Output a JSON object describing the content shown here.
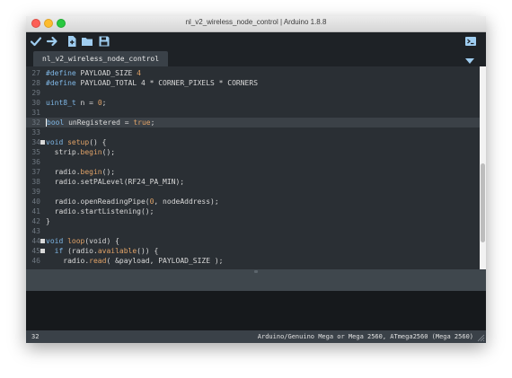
{
  "window": {
    "title": "nl_v2_wireless_node_control | Arduino 1.8.8"
  },
  "toolbar": {
    "verify_icon": "checkmark-icon",
    "upload_icon": "arrow-right-icon",
    "new_icon": "new-file-icon",
    "open_icon": "folder-icon",
    "save_icon": "floppy-icon",
    "serial_icon": "serial-monitor-icon"
  },
  "tabs": [
    {
      "label": "nl_v2_wireless_node_control"
    }
  ],
  "editor": {
    "current_line": 32,
    "lines": [
      {
        "n": "27",
        "segments": [
          {
            "t": "#define",
            "c": "dir"
          },
          {
            "t": " PAYLOAD_SIZE ",
            "c": ""
          },
          {
            "t": "4",
            "c": "val"
          }
        ]
      },
      {
        "n": "28",
        "segments": [
          {
            "t": "#define",
            "c": "dir"
          },
          {
            "t": " PAYLOAD_TOTAL 4 * CORNER_PIXELS * CORNERS",
            "c": ""
          }
        ]
      },
      {
        "n": "29",
        "segments": []
      },
      {
        "n": "30",
        "segments": [
          {
            "t": "uint8_t",
            "c": "kw"
          },
          {
            "t": " n = ",
            "c": ""
          },
          {
            "t": "0",
            "c": "val"
          },
          {
            "t": ";",
            "c": ""
          }
        ]
      },
      {
        "n": "31",
        "segments": []
      },
      {
        "n": "32",
        "current": true,
        "segments": [
          {
            "t": "bool",
            "c": "kw"
          },
          {
            "t": " unRegistered = ",
            "c": ""
          },
          {
            "t": "true",
            "c": "val"
          },
          {
            "t": ";",
            "c": ""
          }
        ]
      },
      {
        "n": "33",
        "segments": []
      },
      {
        "n": "34",
        "fold": true,
        "segments": [
          {
            "t": "void",
            "c": "kw"
          },
          {
            "t": " ",
            "c": ""
          },
          {
            "t": "setup",
            "c": "fn"
          },
          {
            "t": "() {",
            "c": ""
          }
        ]
      },
      {
        "n": "35",
        "segments": [
          {
            "t": "  strip.",
            "c": ""
          },
          {
            "t": "begin",
            "c": "fn"
          },
          {
            "t": "();",
            "c": ""
          }
        ]
      },
      {
        "n": "36",
        "segments": []
      },
      {
        "n": "37",
        "segments": [
          {
            "t": "  radio.",
            "c": ""
          },
          {
            "t": "begin",
            "c": "fn"
          },
          {
            "t": "();",
            "c": ""
          }
        ]
      },
      {
        "n": "38",
        "segments": [
          {
            "t": "  radio.setPALevel(RF24_PA_MIN);",
            "c": ""
          }
        ]
      },
      {
        "n": "39",
        "segments": []
      },
      {
        "n": "40",
        "segments": [
          {
            "t": "  radio.openReadingPipe(",
            "c": ""
          },
          {
            "t": "0",
            "c": "val"
          },
          {
            "t": ", nodeAddress);",
            "c": ""
          }
        ]
      },
      {
        "n": "41",
        "segments": [
          {
            "t": "  radio.startListening();",
            "c": ""
          }
        ]
      },
      {
        "n": "42",
        "segments": [
          {
            "t": "}",
            "c": "brk"
          }
        ]
      },
      {
        "n": "43",
        "segments": []
      },
      {
        "n": "44",
        "fold": true,
        "segments": [
          {
            "t": "void",
            "c": "kw"
          },
          {
            "t": " ",
            "c": ""
          },
          {
            "t": "loop",
            "c": "fn"
          },
          {
            "t": "(void) {",
            "c": ""
          }
        ]
      },
      {
        "n": "45",
        "fold": true,
        "segments": [
          {
            "t": "  ",
            "c": ""
          },
          {
            "t": "if",
            "c": "kw"
          },
          {
            "t": " (radio.",
            "c": ""
          },
          {
            "t": "available",
            "c": "fn"
          },
          {
            "t": "()) {",
            "c": ""
          }
        ]
      },
      {
        "n": "46",
        "segments": [
          {
            "t": "    radio.",
            "c": ""
          },
          {
            "t": "read",
            "c": "fn"
          },
          {
            "t": "( &payload, PAYLOAD_SIZE );",
            "c": ""
          }
        ]
      }
    ]
  },
  "status": {
    "line": "32",
    "board": "Arduino/Genuino Mega or Mega 2560, ATmega2560 (Mega 2560)"
  },
  "colors": {
    "editor_bg": "#2a2f34",
    "keyword": "#7fb7e6",
    "function": "#e0a267",
    "text": "#d9d9d9",
    "line_number": "#6e7780"
  }
}
